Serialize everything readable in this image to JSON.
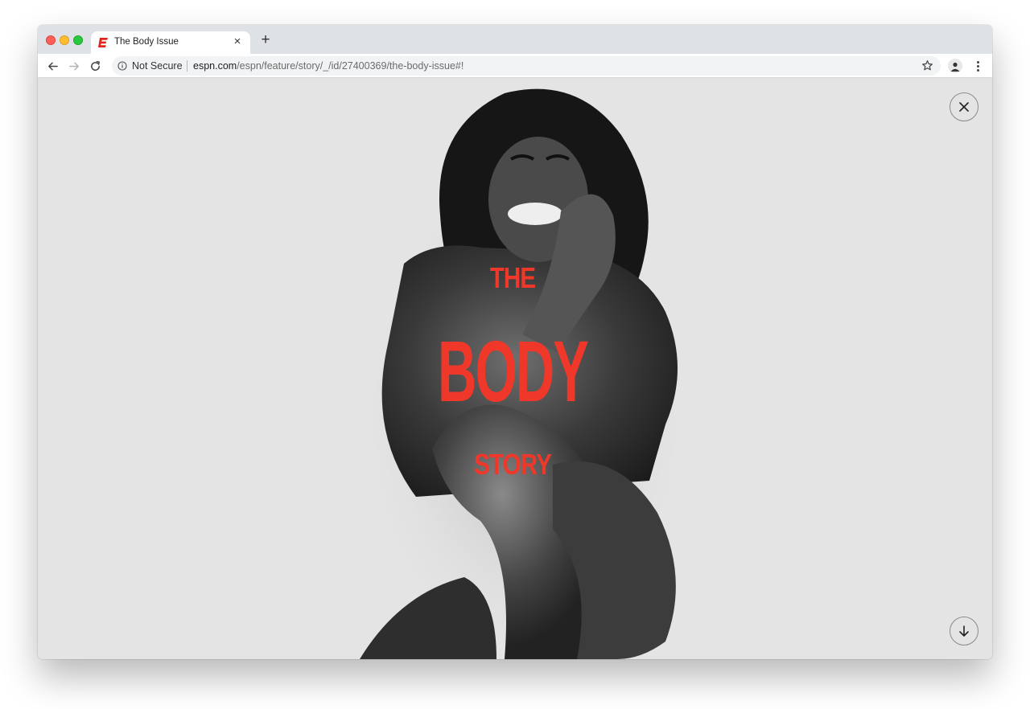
{
  "browser": {
    "tab": {
      "title": "The Body Issue",
      "close_glyph": "×",
      "favicon": "espn-logo-icon",
      "favicon_color": "#e0261b"
    },
    "new_tab_glyph": "+",
    "toolbar": {
      "security_label": "Not Secure",
      "url_domain": "espn.com",
      "url_path": "/espn/feature/story/_/id/27400369/the-body-issue#!"
    }
  },
  "page": {
    "title_line1": "THE",
    "title_line2": "BODY",
    "title_line3": "STORY",
    "title_color": "#ef3829",
    "background_color": "#e4e4e4",
    "close_button": "close-icon",
    "scroll_button": "arrow-down-icon"
  }
}
